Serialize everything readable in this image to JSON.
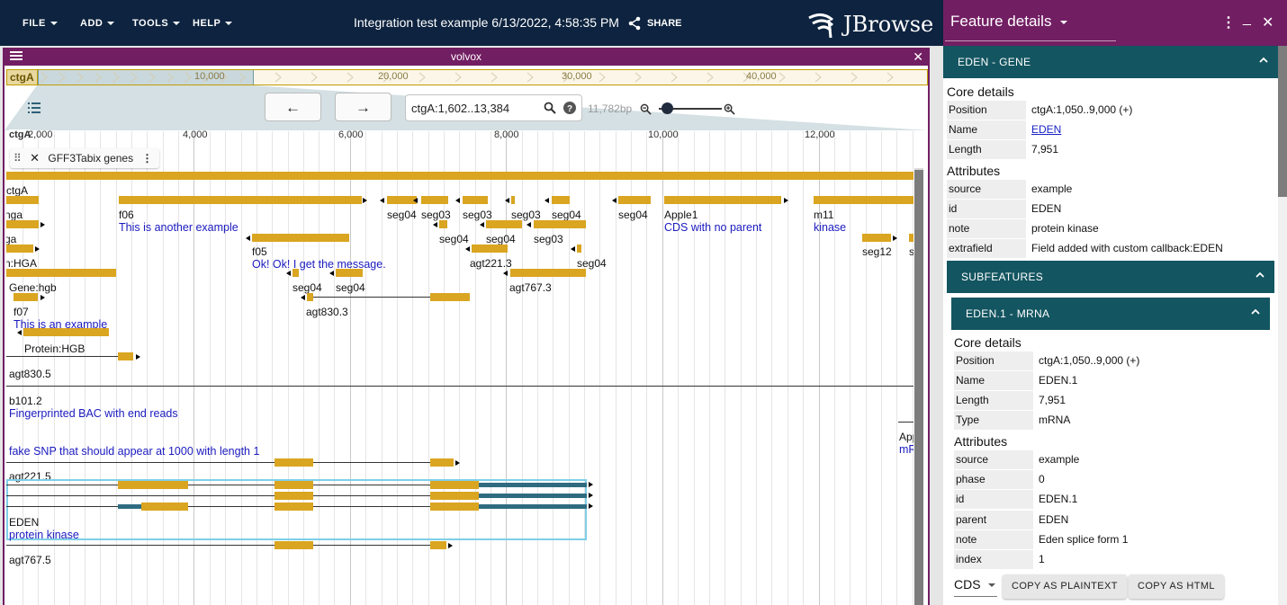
{
  "menu": {
    "file": "FILE",
    "add": "ADD",
    "tools": "TOOLS",
    "help": "HELP"
  },
  "header": {
    "session_title": "Integration test example 6/13/2022, 4:58:35 PM",
    "share": "SHARE",
    "logo_text": "JBrowse"
  },
  "view": {
    "name": "volvox",
    "overview_ref": "ctgA",
    "overview_ticks": [
      "10,000",
      "20,000",
      "30,000",
      "40,000"
    ],
    "location": "ctgA:1,602..13,384",
    "bp_label": "11,782bp",
    "scale_ref": "ctgA",
    "scale_ticks": [
      "2,000",
      "4,000",
      "6,000",
      "8,000",
      "10,000",
      "12,000"
    ],
    "track_label": "GFF3Tabix genes"
  },
  "features": {
    "labels": [
      "ctgA",
      "nga",
      "ga",
      "n:HGA",
      "Gene:hgb",
      "f07",
      "Protein:HGB",
      "agt830.5",
      "f06",
      "f05",
      "seg04",
      "seg03",
      "seg04",
      "seg03",
      "seg04",
      "seg04",
      "seg03",
      "seg04",
      "agt221.3",
      "seg04",
      "seg04",
      "seg04",
      "agt830.3",
      "agt767.3",
      "seg04",
      "Apple1",
      "m11",
      "seg12",
      "se",
      "b101.2",
      "agt221.5",
      "EDEN",
      "agt767.5",
      "App",
      "seg03"
    ],
    "descriptions": [
      "This is another example",
      "Ok! Ok! I get the message.",
      "Fingerprinted BAC with end reads",
      "fake SNP that should appear at 1000 with length 1",
      "protein kinase",
      "CDS with no parent",
      "kinase",
      "This is an example",
      "mR"
    ]
  },
  "panel": {
    "title": "Feature details",
    "gene_header": "EDEN - GENE",
    "core_details": "Core details",
    "attributes": "Attributes",
    "gene_core": [
      {
        "key": "Position",
        "value": "ctgA:1,050..9,000 (+)"
      },
      {
        "key": "Name",
        "value": "EDEN"
      },
      {
        "key": "Length",
        "value": "7,951"
      }
    ],
    "gene_attrs": [
      {
        "key": "source",
        "value": "example"
      },
      {
        "key": "id",
        "value": "EDEN"
      },
      {
        "key": "note",
        "value": "protein kinase"
      },
      {
        "key": "extrafield",
        "value": "Field added with custom callback:EDEN"
      }
    ],
    "subfeatures_header": "SUBFEATURES",
    "mrna_header": "EDEN.1 - MRNA",
    "mrna_core": [
      {
        "key": "Position",
        "value": "ctgA:1,050..9,000 (+)"
      },
      {
        "key": "Name",
        "value": "EDEN.1"
      },
      {
        "key": "Length",
        "value": "7,951"
      },
      {
        "key": "Type",
        "value": "mRNA"
      }
    ],
    "mrna_attrs": [
      {
        "key": "source",
        "value": "example"
      },
      {
        "key": "phase",
        "value": "0"
      },
      {
        "key": "id",
        "value": "EDEN.1"
      },
      {
        "key": "parent",
        "value": "EDEN"
      },
      {
        "key": "note",
        "value": "Eden splice form 1"
      },
      {
        "key": "index",
        "value": "1"
      }
    ],
    "seq_type": "CDS",
    "copy_plain": "COPY AS PLAINTEXT",
    "copy_html": "COPY AS HTML"
  },
  "colors": {
    "app_bar": "#0d233f",
    "view_accent": "#721e63",
    "panel_accordion": "#135560",
    "feature_fill": "#daa520",
    "utr_fill": "#2e6b80",
    "description_text": "#1a1ac0"
  },
  "icons": {
    "menu": "hamburger-icon",
    "share": "share-icon",
    "search": "search-icon",
    "help": "help-icon",
    "zoom_out": "zoom-out-icon",
    "zoom_in": "zoom-in-icon",
    "back": "arrow-left-icon",
    "forward": "arrow-right-icon",
    "close": "close-icon",
    "drag": "drag-handle-icon",
    "kebab": "more-vert-icon",
    "minimize": "minimize-icon",
    "expand": "chevron-up-icon"
  }
}
